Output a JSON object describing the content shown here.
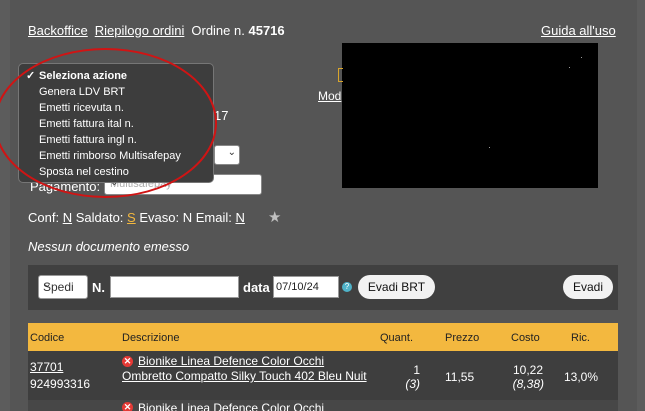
{
  "header": {
    "nav_backoffice": "Backoffice",
    "nav_riepilogo": "Riepilogo ordini",
    "order_label": "Ordine n.",
    "order_number": "45716",
    "guide_link": "Guida all'uso"
  },
  "partial": {
    "mod_link": "Mod",
    "number_fragment": "17",
    "payment_label": "Pagamento:",
    "payment_value": "Multisafepay"
  },
  "action_menu": {
    "items": [
      "Seleziona azione",
      "Genera LDV BRT",
      "Emetti ricevuta n.",
      "Emetti fattura ital n.",
      "Emetti fattura ingl n.",
      "Emetti rimborso Multisafepay",
      "Sposta nel cestino"
    ],
    "selected_index": 0
  },
  "status": {
    "conf_label": "Conf:",
    "conf_value": "N",
    "saldato_label": "Saldato:",
    "saldato_value": "S",
    "evaso_label": "Evaso:",
    "evaso_value": "N",
    "email_label": "Email:",
    "email_value": "N",
    "star_icon": "star-icon"
  },
  "no_document": "Nessun documento emesso",
  "shipping_bar": {
    "method_value": "Spedi",
    "n_label": "N.",
    "n_value": "",
    "date_label": "data",
    "date_value": "07/10/24",
    "help_icon": "question-icon",
    "evadi_brt_label": "Evadi BRT",
    "evadi_label": "Evadi"
  },
  "table": {
    "headers": [
      "Codice",
      "Descrizione",
      "Quant.",
      "Prezzo",
      "Costo",
      "Ric."
    ],
    "rows": [
      {
        "code": "37701",
        "ean": "924993316",
        "description": "Bionike Linea Defence Color Occhi Ombretto Compatto Silky Touch 402 Bleu Nuit",
        "qty": "1",
        "qty_sub": "(3)",
        "price": "11,55",
        "cost": "10,22",
        "cost_sub": "(8,38)",
        "ric": "13,0%"
      },
      {
        "description": "Bionike Linea Defence Color Occhi"
      }
    ]
  },
  "colors": {
    "background": "#555555",
    "header_row": "#f3b83f",
    "annotation_circle": "#d01414",
    "remove_icon": "#e53935"
  }
}
